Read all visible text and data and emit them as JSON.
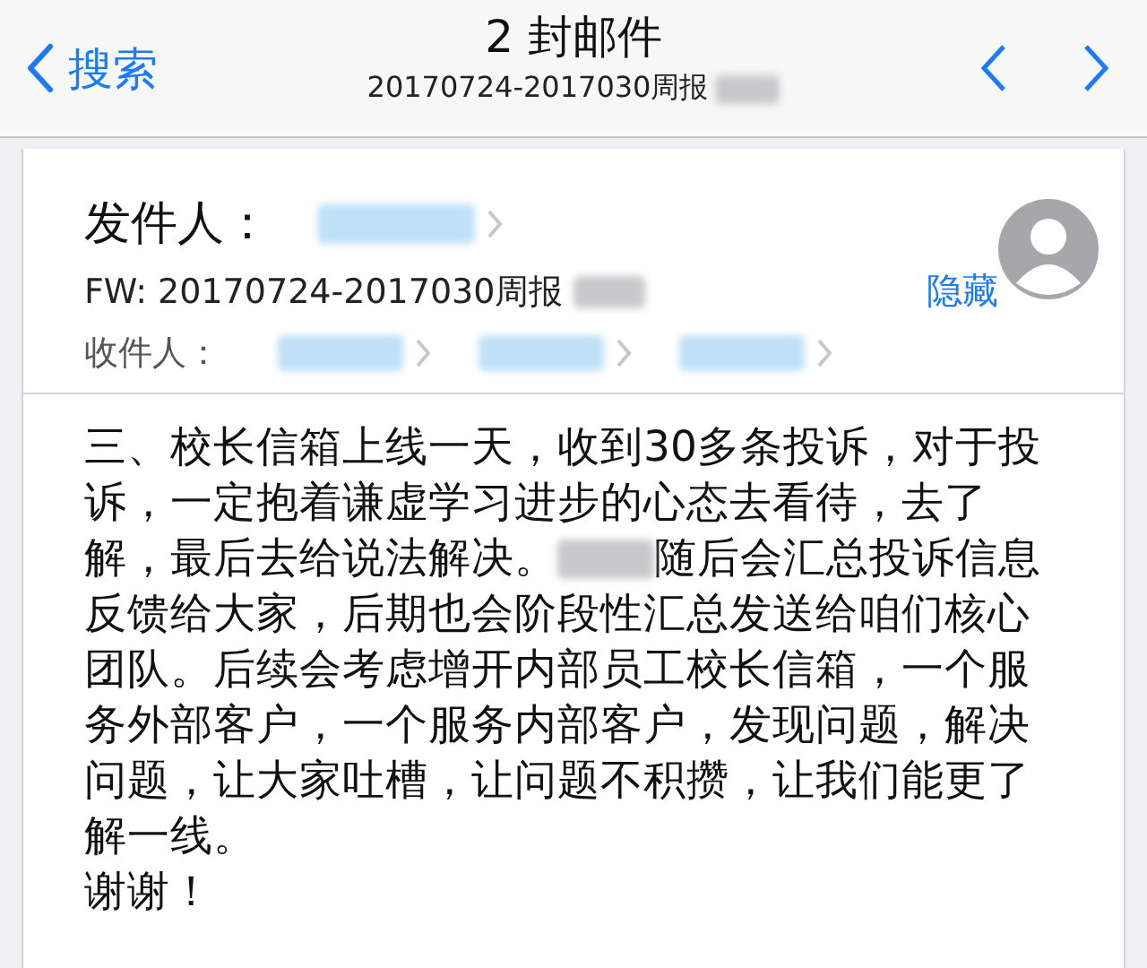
{
  "nav": {
    "back": "搜索",
    "title": "2 封邮件",
    "subtitle": "20170724-2017030周报",
    "subtitle_redacted": true
  },
  "header": {
    "sender_label": "发件人：",
    "sender_redacted": true,
    "subject": "FW: 20170724-2017030周报",
    "subject_redacted": true,
    "hide": "隐藏",
    "recipients_label": "收件人：",
    "recipients": [
      {
        "redacted": true
      },
      {
        "redacted": true
      },
      {
        "redacted": true
      }
    ]
  },
  "body": {
    "lines": [
      {
        "text": "三、校长信箱上线一天，收到30多条投诉，对于投"
      },
      {
        "text": "诉，一定抱着谦虚学习进步的心态去看待，去了"
      },
      {
        "text": "解，最后去给说法解决。",
        "redacted": true,
        "rest": "随后会汇总投诉信息"
      },
      {
        "text": "反馈给大家，后期也会阶段性汇总发送给咱们核心"
      },
      {
        "text": "团队。后续会考虑增开内部员工校长信箱，一个服"
      },
      {
        "text": "务外部客户，一个服务内部客户，发现问题，解决"
      },
      {
        "text": "问题，让大家吐槽，让问题不积攒，让我们能更了"
      },
      {
        "text": "解一线。"
      }
    ],
    "closing": "谢谢！"
  }
}
